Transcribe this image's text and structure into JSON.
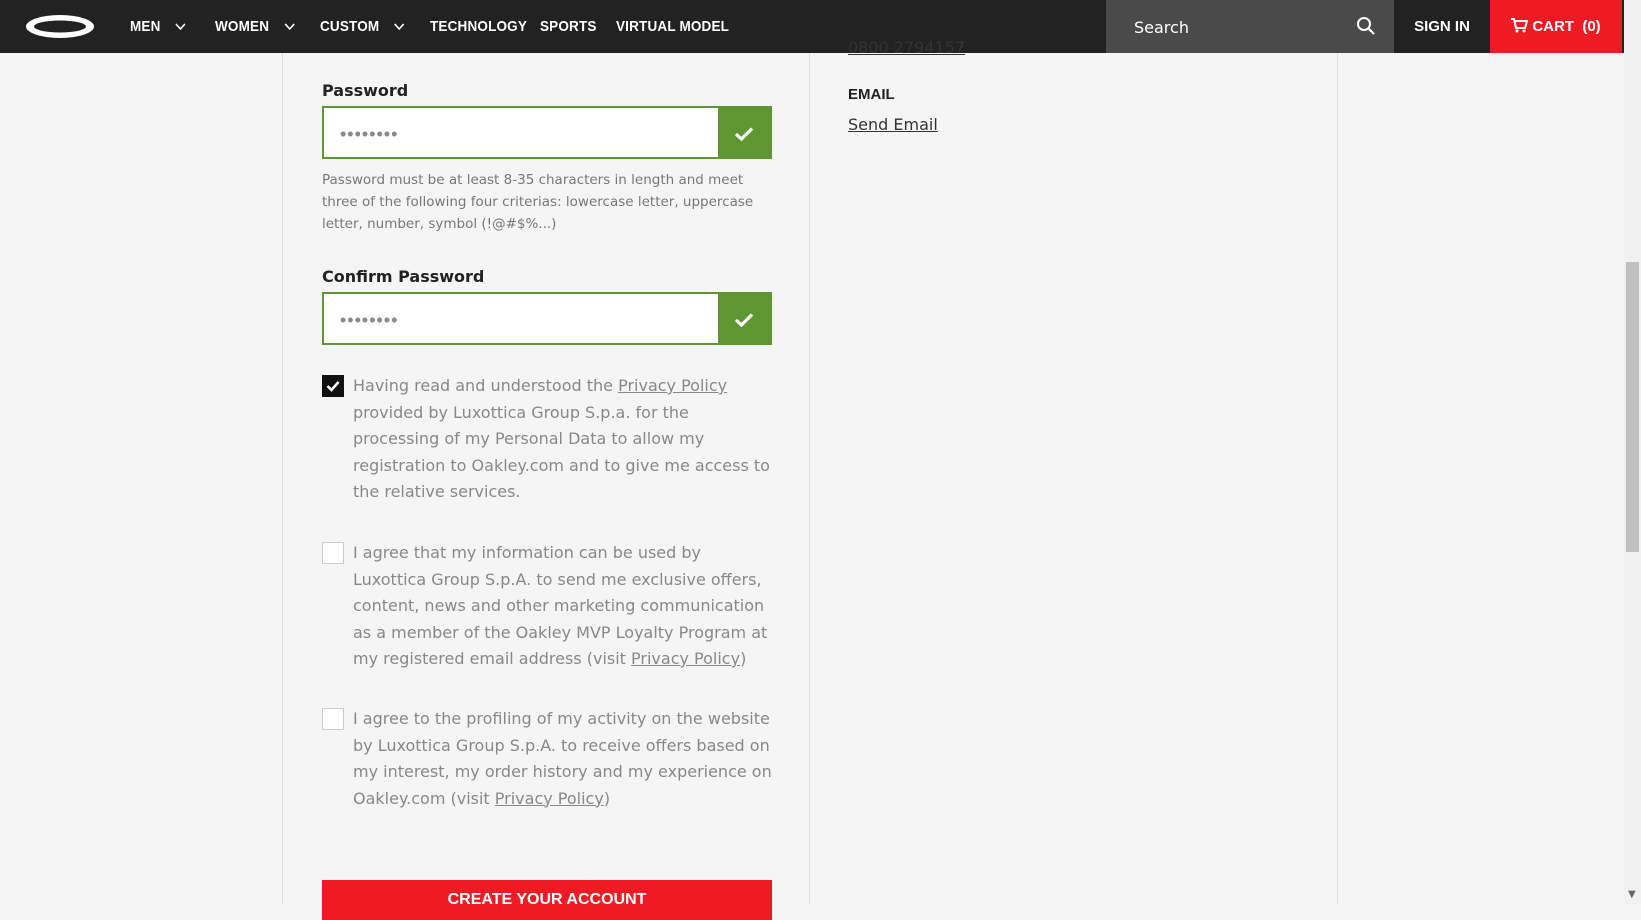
{
  "nav": {
    "items": [
      "MEN",
      "WOMEN",
      "CUSTOM",
      "TECHNOLOGY",
      "SPORTS",
      "VIRTUAL MODEL"
    ],
    "search_placeholder": "Search",
    "signin": "SIGN IN",
    "cart": "CART  (0)"
  },
  "form": {
    "password_label": "Password",
    "password_value": "••••••••",
    "password_hint": "Password must be at least 8-35 characters in length and meet three of the following four criterias: lowercase letter, uppercase letter, number, symbol (!@#$%...)",
    "confirm_label": "Confirm Password",
    "confirm_value": "••••••••",
    "consent1_before": "Having read and understood the ",
    "consent1_link": "Privacy Policy",
    "consent1_after": " provided by Luxottica Group S.p.a. for the processing of my Personal Data to allow my registration to Oakley.com and to give me access to the relative services.",
    "consent2_before": "I agree that my information can be used by Luxottica Group S.p.A. to send me exclusive offers, content, news and other marketing communication as a member of the Oakley MVP Loyalty Program at my registered email address (visit ",
    "consent2_link": "Privacy Policy",
    "consent2_after": ")",
    "consent3_before": "I agree to the profiling of my activity on the website by Luxottica Group S.p.A. to receive offers based on my interest, my order history and my experience on Oakley.com (visit ",
    "consent3_link": "Privacy Policy",
    "consent3_after": ")",
    "create_button": "CREATE YOUR ACCOUNT"
  },
  "contact": {
    "phone": "0800 2794157",
    "email_label": "EMAIL",
    "send_email": "Send Email"
  },
  "colors": {
    "accent_red": "#ee1a24",
    "valid_green": "#5e9732"
  }
}
